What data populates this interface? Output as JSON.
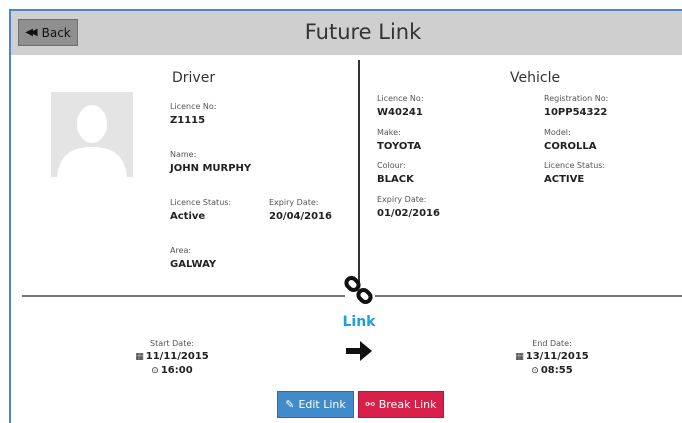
{
  "header": {
    "back_label": "Back",
    "title": "Future Link"
  },
  "driver": {
    "heading": "Driver",
    "licence_no_label": "Licence No:",
    "licence_no": "Z1115",
    "name_label": "Name:",
    "name": "JOHN MURPHY",
    "licence_status_label": "Licence Status:",
    "licence_status": "Active",
    "expiry_label": "Expiry Date:",
    "expiry": "20/04/2016",
    "area_label": "Area:",
    "area": "GALWAY"
  },
  "vehicle": {
    "heading": "Vehicle",
    "licence_no_label": "Licence No:",
    "licence_no": "W40241",
    "registration_label": "Registration No:",
    "registration": "10PP54322",
    "make_label": "Make:",
    "make": "TOYOTA",
    "model_label": "Model:",
    "model": "COROLLA",
    "colour_label": "Colour:",
    "colour": "BLACK",
    "licence_status_label": "Licence Status:",
    "licence_status": "ACTIVE",
    "expiry_label": "Expiry Date:",
    "expiry": "01/02/2016"
  },
  "link": {
    "title": "Link",
    "start_label": "Start Date:",
    "start_date": "11/11/2015",
    "start_time": "16:00",
    "end_label": "End Date:",
    "end_date": "13/11/2015",
    "end_time": "08:55"
  },
  "actions": {
    "edit_label": "Edit Link",
    "break_label": "Break Link"
  },
  "icons": {
    "back": "double-chevron-left-icon",
    "avatar": "user-silhouette-icon",
    "link": "chain-link-icon",
    "arrow": "arrow-right-icon",
    "calendar": "calendar-icon",
    "clock": "clock-icon",
    "edit": "edit-icon",
    "break": "unlink-icon"
  },
  "colors": {
    "accent": "#4a86c8",
    "link_title": "#1fa0d8",
    "edit_button": "#428bca",
    "break_button": "#d9204a",
    "header_bg": "#cfcfcf"
  }
}
